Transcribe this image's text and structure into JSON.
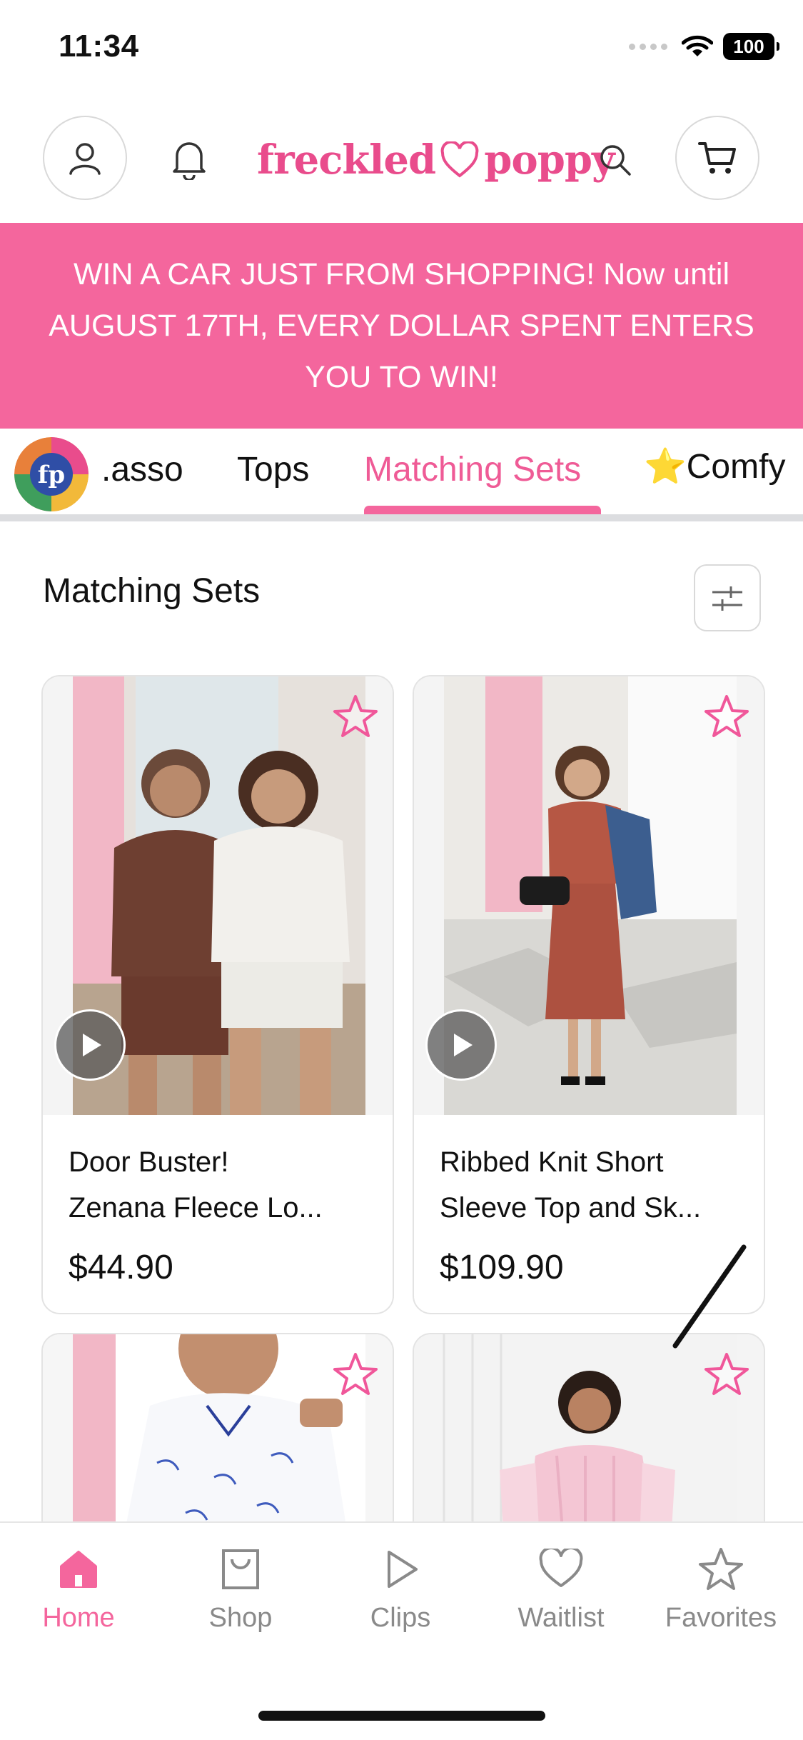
{
  "status_bar": {
    "time": "11:34",
    "battery": "100"
  },
  "header": {
    "logo_text_left": "freckled",
    "logo_text_right": "poppy",
    "icons": [
      "account-icon",
      "bell-icon",
      "search-icon",
      "cart-icon"
    ]
  },
  "promo": {
    "text": "WIN A CAR JUST FROM SHOPPING! Now until AUGUST 17TH, EVERY DOLLAR SPENT ENTERS YOU TO WIN!"
  },
  "tabs": {
    "avatar_text": "fp",
    "items": [
      ".asso",
      "Tops",
      "Matching Sets",
      "⭐Comfy"
    ],
    "active": "Matching Sets"
  },
  "section": {
    "title": "Matching Sets"
  },
  "products": [
    {
      "name_line1": "Door Buster!",
      "name_line2": "Zenana Fleece Lo...",
      "price": "$44.90",
      "has_video": true
    },
    {
      "name_line1": "Ribbed Knit Short",
      "name_line2": "Sleeve Top and Sk...",
      "price": "$109.90",
      "has_video": true
    },
    {
      "name_line1": "",
      "name_line2": "",
      "price": "",
      "has_video": false
    },
    {
      "name_line1": "",
      "name_line2": "",
      "price": "",
      "has_video": false
    }
  ],
  "bottom_nav": [
    {
      "label": "Home",
      "icon": "home-icon",
      "active": true
    },
    {
      "label": "Shop",
      "icon": "bag-icon",
      "active": false
    },
    {
      "label": "Clips",
      "icon": "play-icon",
      "active": false
    },
    {
      "label": "Waitlist",
      "icon": "heart-icon",
      "active": false
    },
    {
      "label": "Favorites",
      "icon": "star-icon",
      "active": false
    }
  ],
  "colors": {
    "brand_pink": "#f4669d",
    "active_tab": "#ef5b96",
    "nav_inactive": "#8a8a8a"
  }
}
